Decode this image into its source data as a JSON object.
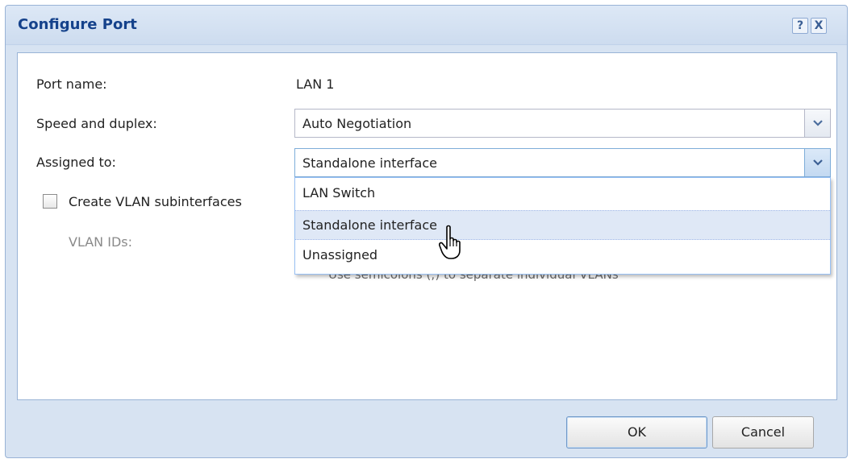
{
  "dialog": {
    "title": "Configure Port",
    "help_label": "?",
    "close_label": "X"
  },
  "form": {
    "port_name_label": "Port name:",
    "port_name_value": "LAN 1",
    "speed_label": "Speed and duplex:",
    "speed_value": "Auto Negotiation",
    "assigned_label": "Assigned to:",
    "assigned_value": "Standalone interface",
    "vlan_checkbox_label": "Create VLAN subinterfaces",
    "vlan_checkbox_checked": false,
    "vlan_ids_label": "VLAN IDs:",
    "vlan_hint": "Use semicolons (;) to separate individual VLANs"
  },
  "dropdown": {
    "options": [
      "LAN Switch",
      "Standalone interface",
      "Unassigned"
    ],
    "selected_index": 1
  },
  "footer": {
    "ok_label": "OK",
    "cancel_label": "Cancel"
  },
  "colors": {
    "title": "#15428b",
    "frame": "#d7e3f2",
    "selected_item": "#dfe8f6"
  }
}
